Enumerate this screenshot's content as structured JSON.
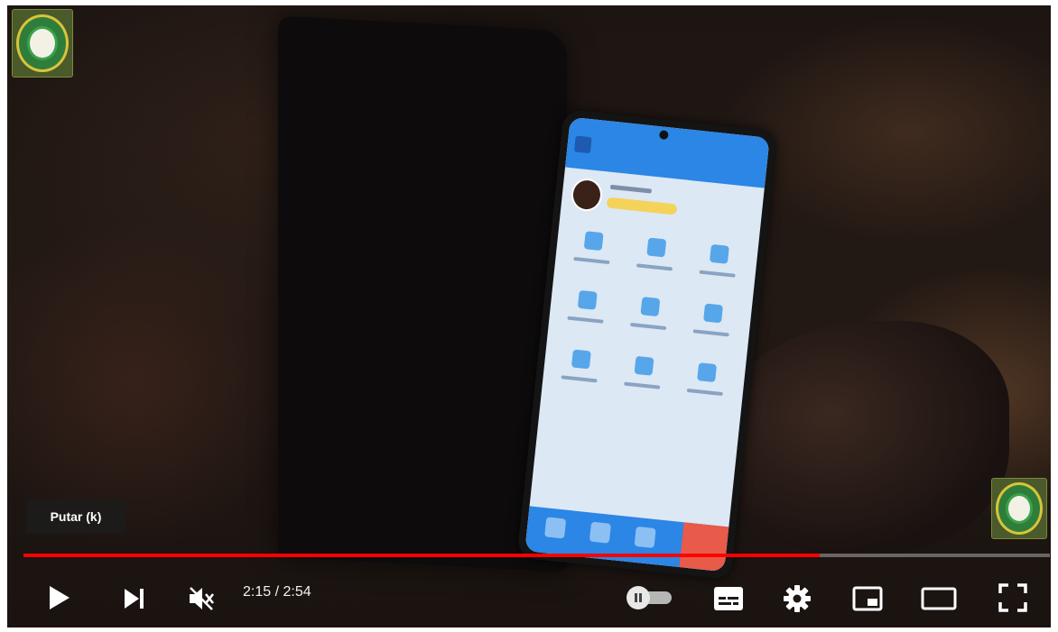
{
  "tooltip": {
    "text": "Putar (k)"
  },
  "playback": {
    "current_time": "2:15",
    "separator": " / ",
    "duration": "2:54",
    "progress_fraction": 0.776
  },
  "colors": {
    "progress": "#ff0000",
    "control_icon": "#ffffff"
  },
  "controls": {
    "play": "play-icon",
    "next": "next-icon",
    "mute": "volume-muted-icon",
    "autoplay": "autoplay-toggle",
    "subtitles": "subtitles-icon",
    "settings": "gear-icon",
    "miniplayer": "miniplayer-icon",
    "theater": "theater-mode-icon",
    "fullscreen": "fullscreen-icon"
  }
}
